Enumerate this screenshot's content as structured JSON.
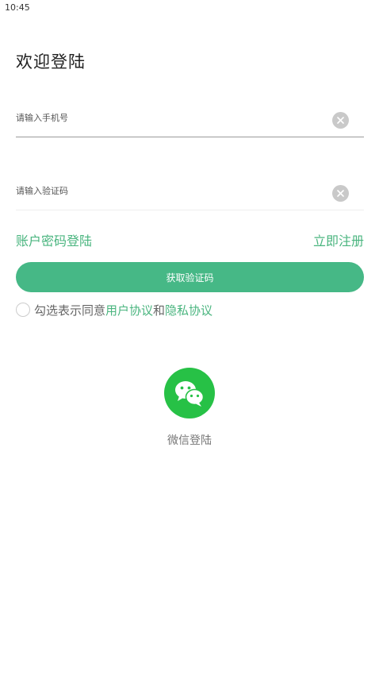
{
  "status_bar": {
    "time": "10:45"
  },
  "page": {
    "title": "欢迎登陆"
  },
  "phone_input": {
    "placeholder": "请输入手机号",
    "value": ""
  },
  "code_input": {
    "placeholder": "请输入验证码",
    "value": ""
  },
  "links": {
    "password_login": "账户密码登陆",
    "register": "立即注册"
  },
  "primary_button": {
    "label": "获取验证码"
  },
  "agreement": {
    "prefix": "勾选表示同意",
    "user_agreement": "用户协议",
    "conjunction": "和",
    "privacy_agreement": "隐私协议"
  },
  "wechat": {
    "label": "微信登陆",
    "icon": "wechat-icon"
  },
  "colors": {
    "accent": "#46b886",
    "link": "#4ab57f",
    "wechat": "#27c146"
  }
}
